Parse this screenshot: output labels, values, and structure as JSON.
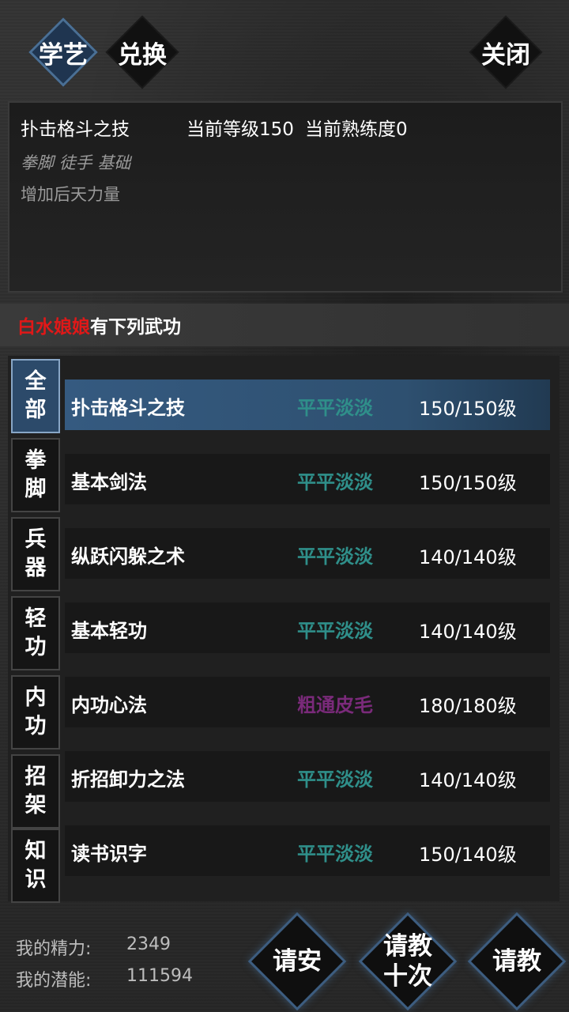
{
  "tabs": {
    "learn": "学艺",
    "exchange": "兑换",
    "close": "关闭"
  },
  "info": {
    "skill_name": "扑击格斗之技",
    "level_text": "当前等级150",
    "proficiency_text": "当前熟练度0",
    "tags": "拳脚 徒手 基础",
    "effect": "增加后天力量"
  },
  "master": {
    "name": "白水娘娘",
    "suffix": "有下列武功"
  },
  "categories": [
    {
      "line1": "全",
      "line2": "部"
    },
    {
      "line1": "拳",
      "line2": "脚"
    },
    {
      "line1": "兵",
      "line2": "器"
    },
    {
      "line1": "轻",
      "line2": "功"
    },
    {
      "line1": "内",
      "line2": "功"
    },
    {
      "line1": "招",
      "line2": "架"
    },
    {
      "line1": "知",
      "line2": "识"
    }
  ],
  "skills": [
    {
      "name": "扑击格斗之技",
      "rank": "平平淡淡",
      "level": "150/150级"
    },
    {
      "name": "基本剑法",
      "rank": "平平淡淡",
      "level": "150/150级"
    },
    {
      "name": "纵跃闪躲之术",
      "rank": "平平淡淡",
      "level": "140/140级"
    },
    {
      "name": "基本轻功",
      "rank": "平平淡淡",
      "level": "140/140级"
    },
    {
      "name": "内功心法",
      "rank": "粗通皮毛",
      "level": "180/180级"
    },
    {
      "name": "折招卸力之法",
      "rank": "平平淡淡",
      "level": "140/140级"
    },
    {
      "name": "读书识字",
      "rank": "平平淡淡",
      "level": "150/140级"
    }
  ],
  "colors": {
    "rank_common": "#2f8f8a",
    "rank_rare": "#7a2a7a",
    "master_name": "#e01818"
  },
  "stats": {
    "energy_label": "我的精力:",
    "energy_value": "2349",
    "potential_label": "我的潜能:",
    "potential_value": "111594"
  },
  "actions": {
    "greet": "请安",
    "teach_ten_line1": "请教",
    "teach_ten_line2": "十次",
    "teach": "请教"
  }
}
